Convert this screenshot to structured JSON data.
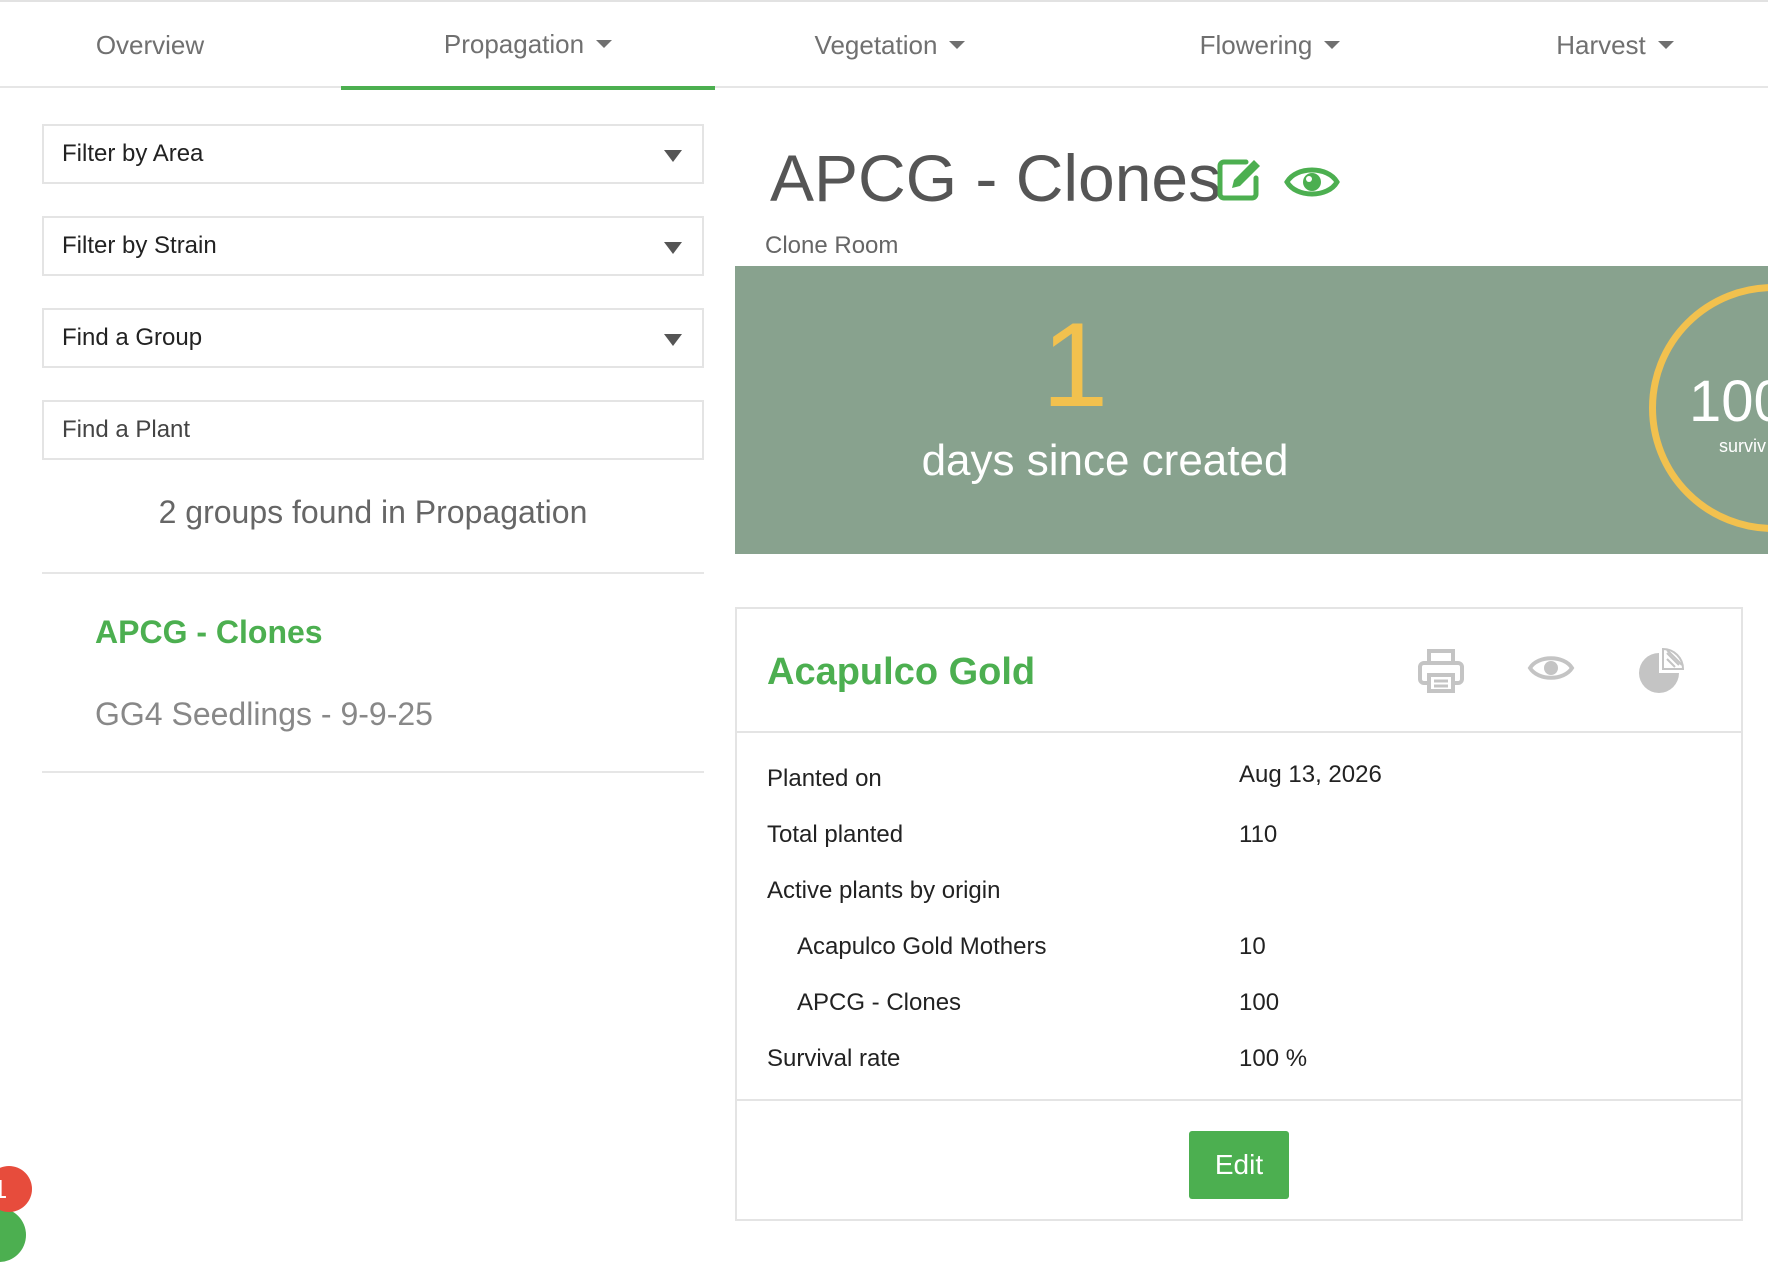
{
  "nav": {
    "tabs": [
      {
        "label": "Overview",
        "dropdown": false
      },
      {
        "label": "Propagation",
        "dropdown": true,
        "active": true
      },
      {
        "label": "Vegetation",
        "dropdown": true
      },
      {
        "label": "Flowering",
        "dropdown": true
      },
      {
        "label": "Harvest",
        "dropdown": true
      }
    ]
  },
  "sidebar": {
    "filter_area": "Filter by Area",
    "filter_strain": "Filter by Strain",
    "find_group": "Find a Group",
    "find_plant_placeholder": "Find a Plant",
    "groups_found": "2 groups found in Propagation",
    "groups": [
      {
        "label": "APCG - Clones",
        "active": true
      },
      {
        "label": "GG4 Seedlings - 9-9-25",
        "active": false
      }
    ]
  },
  "header": {
    "title": "APCG - Clones",
    "location": "Clone Room",
    "icons": [
      "edit-icon",
      "eye-icon"
    ]
  },
  "hero": {
    "days_value": "1",
    "days_caption": "days since created",
    "survival_value": "100",
    "survival_label": "surviv",
    "survival_fraction": 1.0
  },
  "card": {
    "title": "Acapulco Gold",
    "icons": [
      "print-icon",
      "eye-icon",
      "pie-chart-icon"
    ],
    "rows": [
      {
        "label": "Planted on",
        "value": "Aug 13, 2026"
      },
      {
        "label": "Total planted",
        "value": "110"
      },
      {
        "label": "Active plants by origin",
        "value": ""
      },
      {
        "label": "Acapulco Gold Mothers",
        "value": "10",
        "indent": true
      },
      {
        "label": "APCG - Clones",
        "value": "100",
        "indent": true
      },
      {
        "label": "Survival rate",
        "value": "100 %"
      }
    ],
    "edit_label": "Edit"
  },
  "widget": {
    "badge_count": "1"
  },
  "colors": {
    "accent": "#4caf50",
    "hero_bg": "#88a28e",
    "highlight": "#f2c14e",
    "badge": "#e74c3c"
  }
}
